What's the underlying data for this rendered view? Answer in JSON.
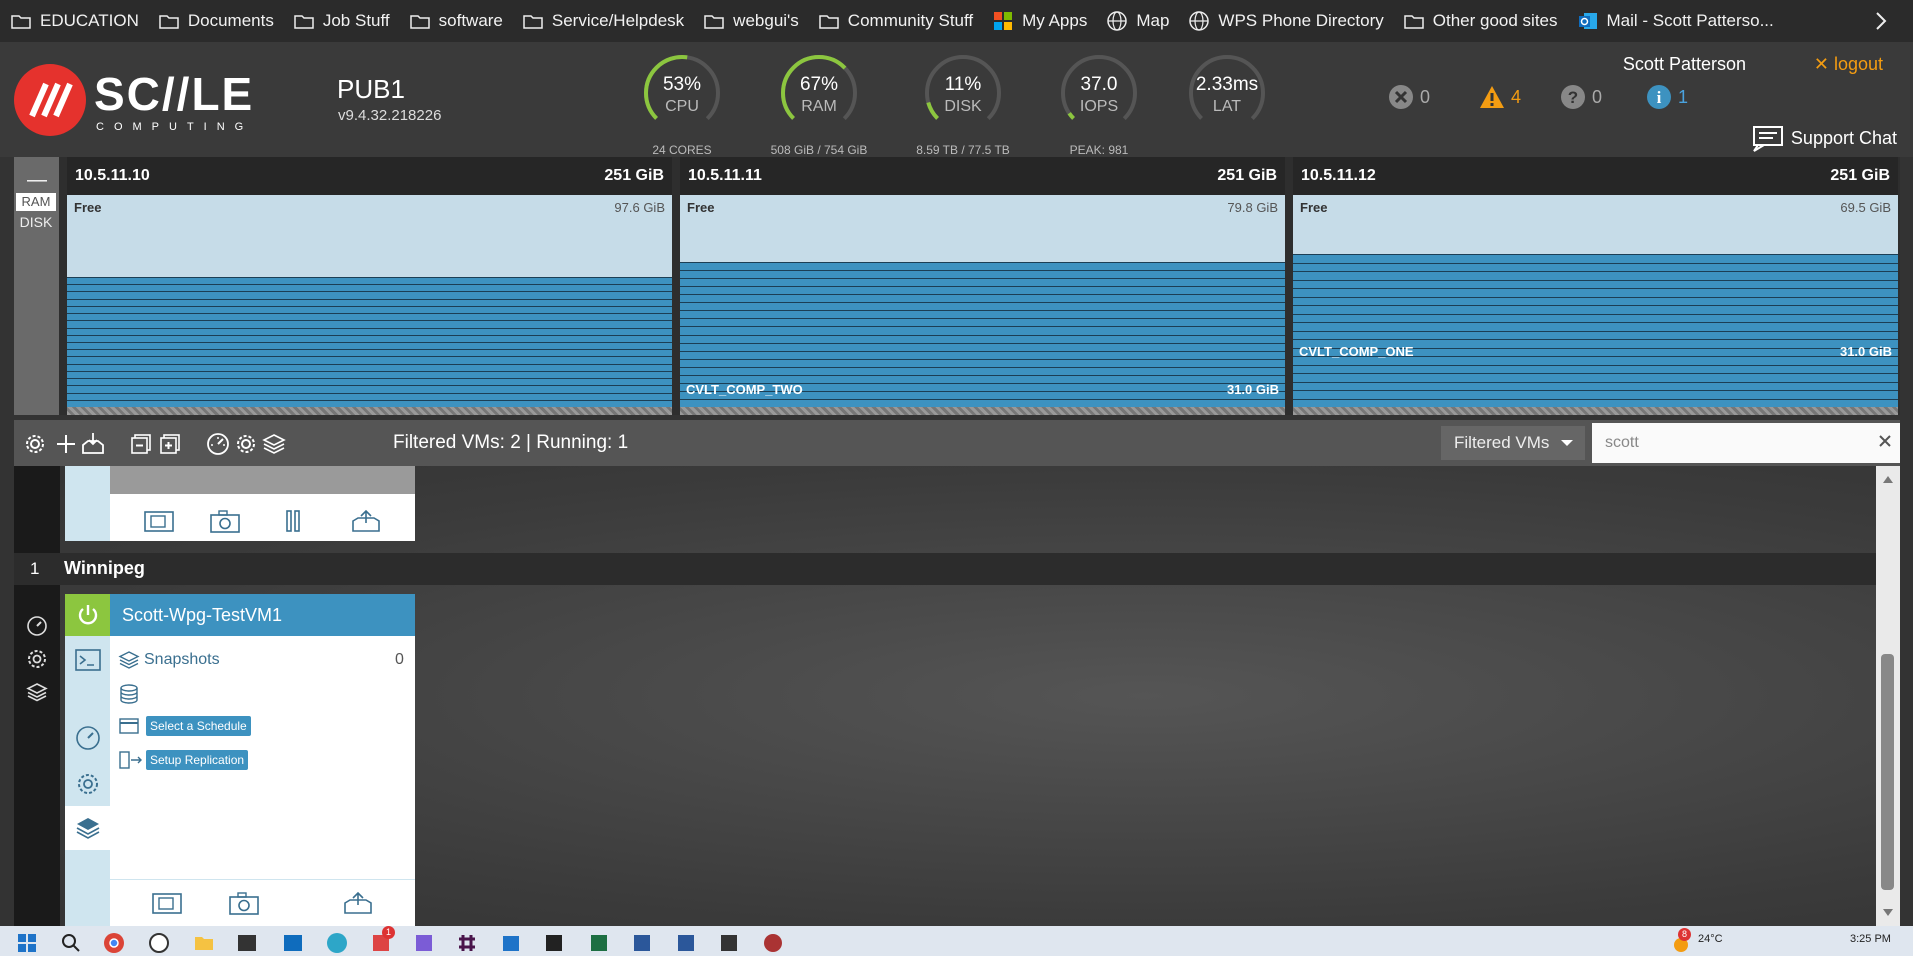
{
  "bookmarks": [
    {
      "label": "EDUCATION",
      "icon": "folder-icon"
    },
    {
      "label": "Documents",
      "icon": "folder-icon"
    },
    {
      "label": "Job Stuff",
      "icon": "folder-icon"
    },
    {
      "label": "software",
      "icon": "folder-icon"
    },
    {
      "label": "Service/Helpdesk",
      "icon": "folder-icon"
    },
    {
      "label": "webgui's",
      "icon": "folder-icon"
    },
    {
      "label": "Community Stuff",
      "icon": "folder-icon"
    },
    {
      "label": "My Apps",
      "icon": "microsoft-icon"
    },
    {
      "label": "Map",
      "icon": "globe-icon"
    },
    {
      "label": "WPS Phone Directory",
      "icon": "globe-icon"
    },
    {
      "label": "Other good sites",
      "icon": "folder-icon"
    },
    {
      "label": "Mail - Scott Patterso...",
      "icon": "outlook-icon"
    }
  ],
  "header": {
    "cluster_name": "PUB1",
    "version": "v9.4.32.218226",
    "user": "Scott Patterson",
    "logout": "✕ logout",
    "support": "Support Chat",
    "status": {
      "errors": "0",
      "warnings": "4",
      "unknown": "0",
      "info": "1"
    },
    "gauges": [
      {
        "value": "53%",
        "label": "CPU",
        "sub": "24 CORES",
        "fraction": 0.53
      },
      {
        "value": "67%",
        "label": "RAM",
        "sub": "508 GiB / 754 GiB",
        "fraction": 0.67
      },
      {
        "value": "11%",
        "label": "DISK",
        "sub": "8.59 TB / 77.5 TB",
        "fraction": 0.11
      },
      {
        "value": "37.0",
        "label": "IOPS",
        "sub": "PEAK: 981",
        "fraction": 0.04
      },
      {
        "value": "2.33ms",
        "label": "LAT",
        "sub": "",
        "fraction": 0.0
      }
    ]
  },
  "node_panel": {
    "collapse": "—",
    "tab_ram": "RAM",
    "tab_disk": "DISK",
    "nodes": [
      {
        "ip": "10.5.11.10",
        "total": "251 GiB",
        "free_label": "Free",
        "free": "97.6 GiB",
        "free_fraction": 0.389,
        "vm": {
          "name": "",
          "size": ""
        }
      },
      {
        "ip": "10.5.11.11",
        "total": "251 GiB",
        "free_label": "Free",
        "free": "79.8 GiB",
        "free_fraction": 0.318,
        "vm": {
          "name": "CVLT_COMP_TWO",
          "size": "31.0 GiB"
        }
      },
      {
        "ip": "10.5.11.12",
        "total": "251 GiB",
        "free_label": "Free",
        "free": "69.5 GiB",
        "free_fraction": 0.277,
        "vm": {
          "name": "CVLT_COMP_ONE",
          "size": "31.0 GiB"
        }
      }
    ]
  },
  "toolbar": {
    "status": "Filtered VMs: 2 | Running: 1",
    "filter_label": "Filtered VMs",
    "search_value": "scott"
  },
  "vm_list": {
    "group": {
      "count": "1",
      "name": "Winnipeg"
    },
    "vm": {
      "name": "Scott-Wpg-TestVM1",
      "snapshots_label": "Snapshots",
      "snapshots_count": "0",
      "schedule_button": "Select a Schedule",
      "replication_button": "Setup Replication"
    }
  },
  "taskbar": {
    "temperature": "24°C",
    "time": "3:25 PM",
    "notification_count": "8",
    "app_badge": "1"
  }
}
